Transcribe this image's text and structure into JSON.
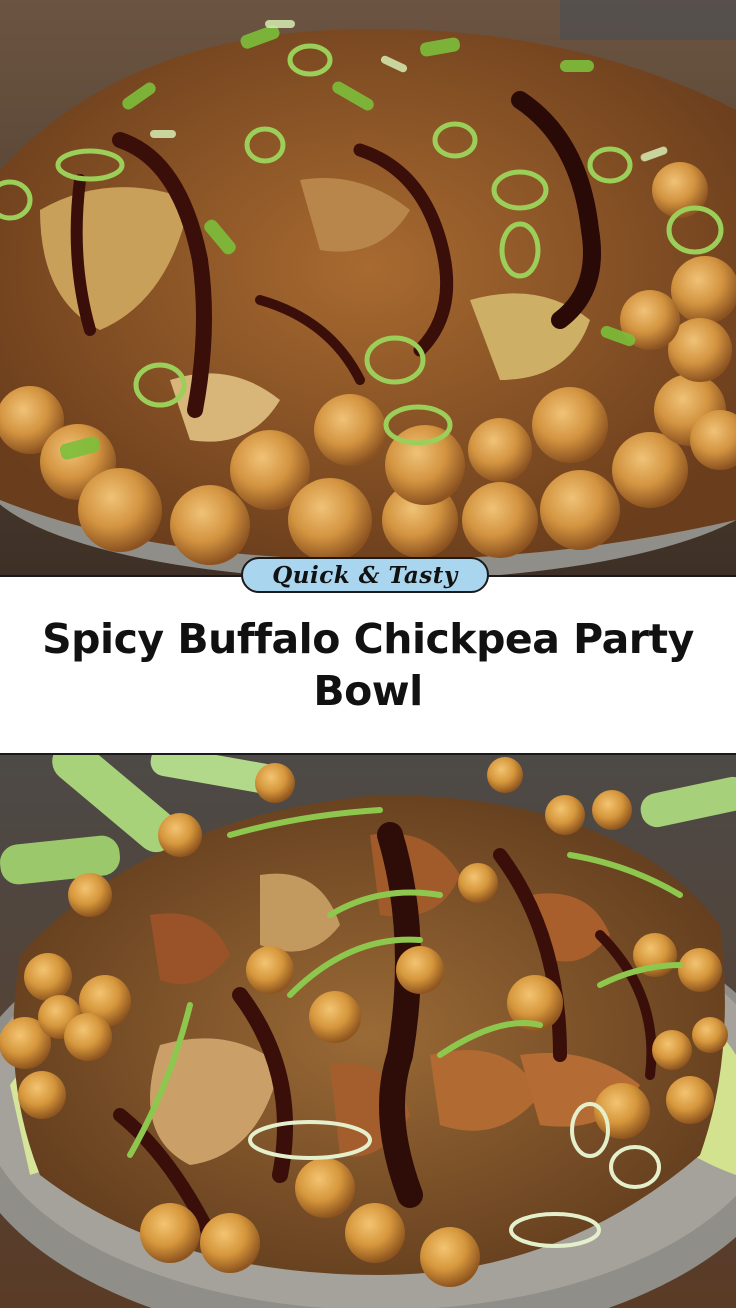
{
  "badge": {
    "label": "Quick & Tasty"
  },
  "title": "Spicy Buffalo Chickpea Party Bowl",
  "colors": {
    "badge_fill": "#a9d6ee",
    "badge_border": "#1b1b1b",
    "title_text": "#111111",
    "chickpea": "#d79a45",
    "sauce": "#3a0f0a",
    "scallion": "#9ccf5a",
    "bowl": "#8f8e88"
  },
  "images": [
    {
      "name": "top-food-photo",
      "subject": "bowl-with-chickpeas-shredded-chicken-scallions-bbq-drizzle"
    },
    {
      "name": "bottom-food-photo",
      "subject": "bowl-with-chickpeas-lettuce-celery-scallions-bbq-drizzle"
    }
  ]
}
